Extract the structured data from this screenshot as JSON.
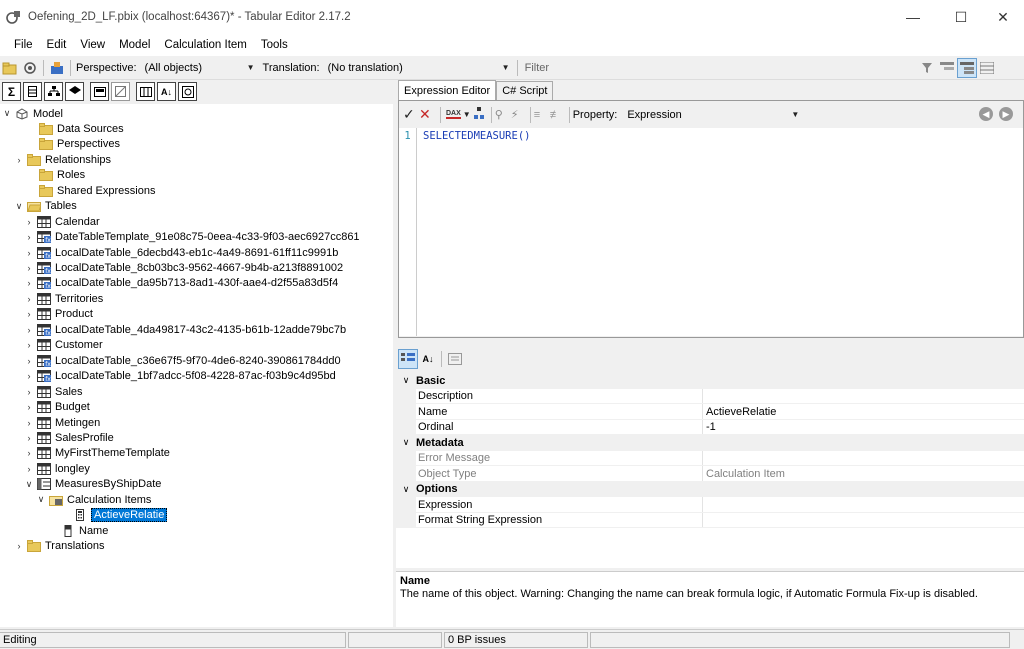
{
  "window": {
    "title": "Oefening_2D_LF.pbix (localhost:64367)* - Tabular Editor 2.17.2",
    "controls": {
      "minimize": "—",
      "maximize": "☐",
      "close": "✕"
    }
  },
  "menu": [
    "File",
    "Edit",
    "View",
    "Model",
    "Calculation Item",
    "Tools"
  ],
  "toolbar": {
    "perspective_label": "Perspective:",
    "perspective_value": "(All objects)",
    "translation_label": "Translation:",
    "translation_value": "(No translation)",
    "filter_placeholder": "Filter"
  },
  "tree": {
    "nodes": [
      {
        "label": "Model",
        "icon": "model-icon"
      },
      {
        "label": "Data Sources",
        "icon": "folder-icon"
      },
      {
        "label": "Perspectives",
        "icon": "folder-icon"
      },
      {
        "label": "Relationships",
        "icon": "folder-icon"
      },
      {
        "label": "Roles",
        "icon": "folder-icon"
      },
      {
        "label": "Shared Expressions",
        "icon": "folder-icon"
      },
      {
        "label": "Tables",
        "icon": "folder-open-icon"
      },
      {
        "label": "Calendar",
        "icon": "table-icon"
      },
      {
        "label": "DateTableTemplate_91e08c75-0eea-4c33-9f03-aec6927cc861",
        "icon": "calc-table-icon"
      },
      {
        "label": "LocalDateTable_6decbd43-eb1c-4a49-8691-61ff11c9991b",
        "icon": "calc-table-icon"
      },
      {
        "label": "LocalDateTable_8cb03bc3-9562-4667-9b4b-a213f8891002",
        "icon": "calc-table-icon"
      },
      {
        "label": "LocalDateTable_da95b713-8ad1-430f-aae4-d2f55a83d5f4",
        "icon": "calc-table-icon"
      },
      {
        "label": "Territories",
        "icon": "table-icon"
      },
      {
        "label": "Product",
        "icon": "table-icon"
      },
      {
        "label": "LocalDateTable_4da49817-43c2-4135-b61b-12adde79bc7b",
        "icon": "calc-table-icon"
      },
      {
        "label": "Customer",
        "icon": "table-icon"
      },
      {
        "label": "LocalDateTable_c36e67f5-9f70-4de6-8240-390861784dd0",
        "icon": "calc-table-icon"
      },
      {
        "label": "LocalDateTable_1bf7adcc-5f08-4228-87ac-f03b9c4d95bd",
        "icon": "calc-table-icon"
      },
      {
        "label": "Sales",
        "icon": "table-icon"
      },
      {
        "label": "Budget",
        "icon": "table-icon"
      },
      {
        "label": "Metingen",
        "icon": "table-icon"
      },
      {
        "label": "SalesProfile",
        "icon": "table-icon"
      },
      {
        "label": "MyFirstThemeTemplate",
        "icon": "table-icon"
      },
      {
        "label": "longley",
        "icon": "table-icon"
      },
      {
        "label": "MeasuresByShipDate",
        "icon": "calc-group-icon"
      },
      {
        "label": "Calculation Items",
        "icon": "calc-items-folder-icon"
      },
      {
        "label": "ActieveRelatie",
        "icon": "calc-item-icon"
      },
      {
        "label": "Name",
        "icon": "column-icon"
      },
      {
        "label": "Translations",
        "icon": "folder-icon"
      }
    ]
  },
  "editor": {
    "tabs": [
      "Expression Editor",
      "C# Script"
    ],
    "property_label": "Property:",
    "property_value": "Expression",
    "line_number": "1",
    "code": "SELECTEDMEASURE()",
    "dax_badge": "DAX"
  },
  "properties": {
    "categories": [
      {
        "name": "Basic",
        "rows": [
          {
            "name": "Description",
            "value": "",
            "dim": false
          },
          {
            "name": "Name",
            "value": "ActieveRelatie",
            "dim": false
          },
          {
            "name": "Ordinal",
            "value": "-1",
            "dim": false
          }
        ]
      },
      {
        "name": "Metadata",
        "rows": [
          {
            "name": "Error Message",
            "value": "",
            "dim": true
          },
          {
            "name": "Object Type",
            "value": "Calculation Item",
            "dim": true
          }
        ]
      },
      {
        "name": "Options",
        "rows": [
          {
            "name": "Expression",
            "value": "",
            "dim": false
          },
          {
            "name": "Format String Expression",
            "value": "",
            "dim": false
          }
        ]
      }
    ]
  },
  "description": {
    "title": "Name",
    "text": "The name of this object. Warning: Changing the name can break formula logic, if Automatic Formula Fix-up is disabled."
  },
  "status": {
    "left": "Editing",
    "issues": "0 BP issues"
  }
}
